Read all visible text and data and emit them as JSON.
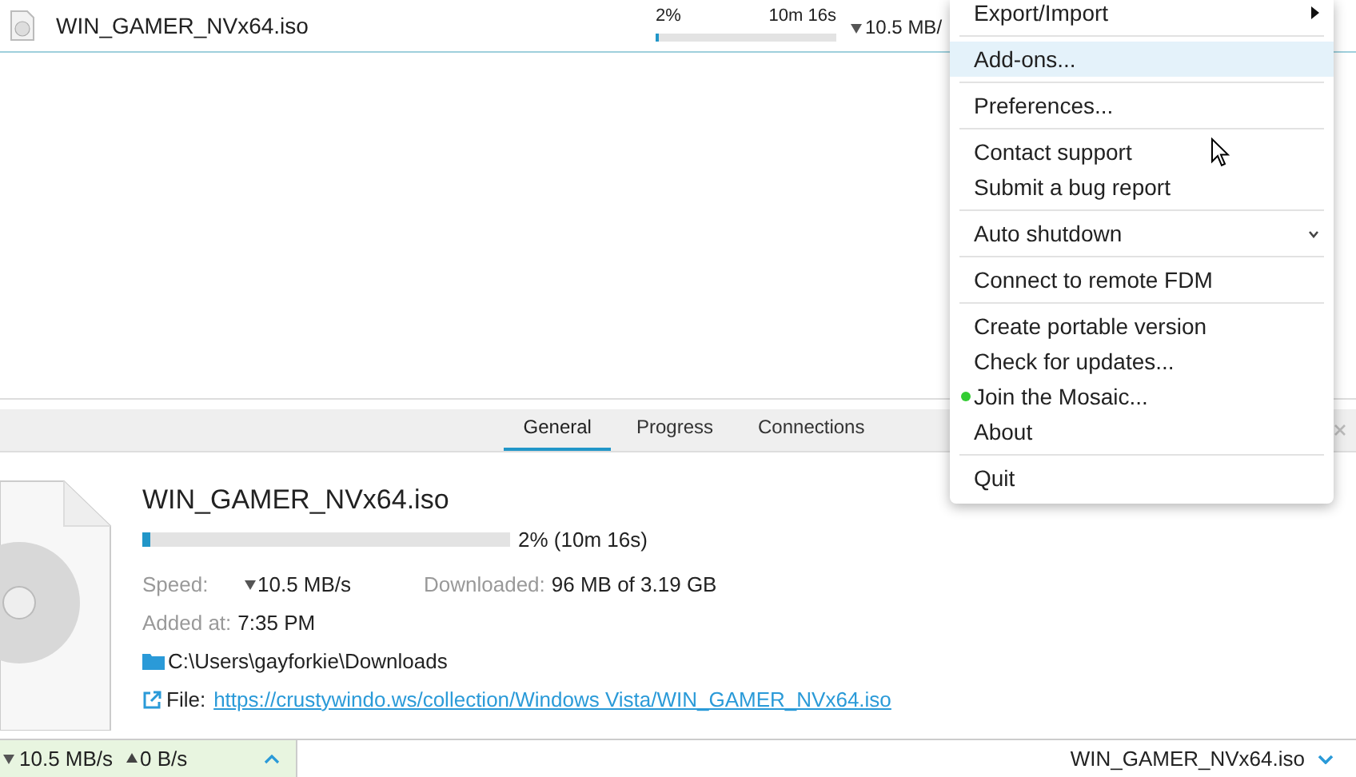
{
  "download_list": [
    {
      "name": "WIN_GAMER_NVx64.iso",
      "percent": "2%",
      "remaining": "10m 16s",
      "level": 0.02,
      "speed": "10.5 MB/"
    }
  ],
  "detail_tabs": [
    {
      "label": "General",
      "selected": true
    },
    {
      "label": "Progress",
      "selected": false
    },
    {
      "label": "Connections",
      "selected": false
    }
  ],
  "details": {
    "name": "WIN_GAMER_NVx64.iso",
    "level": 0.02,
    "progress_text": "2% (10m 16s)",
    "speed_label": "Speed:",
    "speed": "10.5 MB/s",
    "downloaded_label": "Downloaded:",
    "downloaded": "96 MB of 3.19 GB",
    "added_label": "Added at:",
    "added": "7:35 PM",
    "folder": "C:\\Users\\gayforkie\\Downloads",
    "file_label": "File:",
    "file_url": "https://crustywindo.ws/collection/Windows Vista/WIN_GAMER_NVx64.iso"
  },
  "status_bar": {
    "download_speed": "10.5 MB/s",
    "upload_speed": "0 B/s",
    "current_file": "WIN_GAMER_NVx64.iso"
  },
  "menu": [
    [
      {
        "label": "Export/Import",
        "kind": "submenu",
        "selected": false
      }
    ],
    [
      {
        "label": "Add-ons...",
        "kind": "item",
        "selected": true
      }
    ],
    [
      {
        "label": "Preferences...",
        "kind": "item",
        "selected": false
      }
    ],
    [
      {
        "label": "Contact support",
        "kind": "item",
        "selected": false
      },
      {
        "label": "Submit a bug report",
        "kind": "item",
        "selected": false
      }
    ],
    [
      {
        "label": "Auto shutdown",
        "kind": "expand",
        "selected": false
      }
    ],
    [
      {
        "label": "Connect to remote FDM",
        "kind": "item",
        "selected": false
      }
    ],
    [
      {
        "label": "Create portable version",
        "kind": "item",
        "selected": false
      },
      {
        "label": "Check for updates...",
        "kind": "item",
        "selected": false
      },
      {
        "label": "Join the Mosaic...",
        "kind": "dot",
        "color": "#33cc33",
        "selected": false
      },
      {
        "label": "About",
        "kind": "item",
        "selected": false
      }
    ],
    [
      {
        "label": "Quit",
        "kind": "item",
        "selected": false
      }
    ]
  ]
}
